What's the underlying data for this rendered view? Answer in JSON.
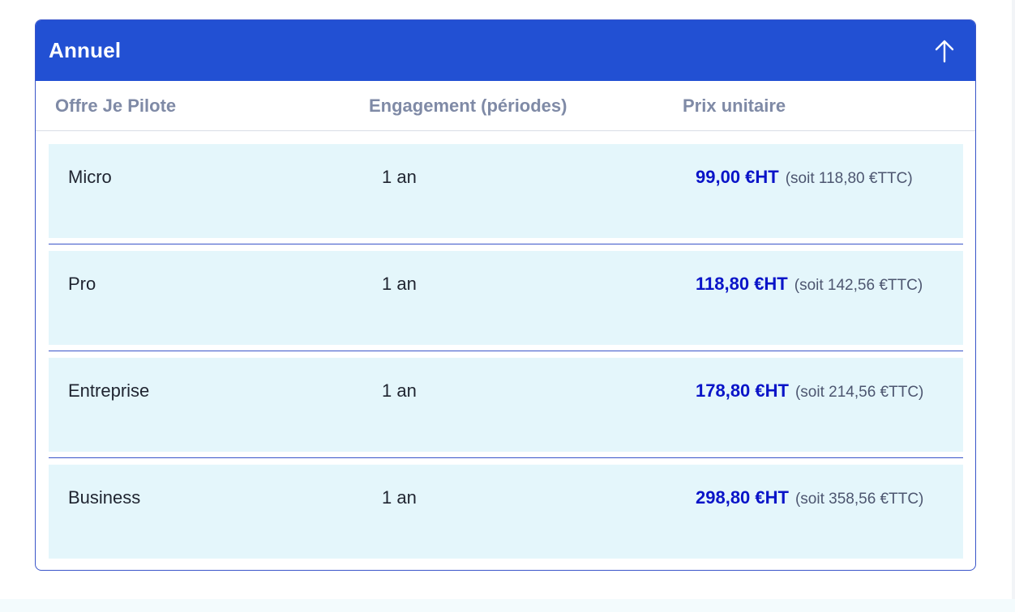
{
  "panel": {
    "title": "Annuel",
    "toggle_icon": "arrow-up-icon"
  },
  "columns": {
    "offer": "Offre Je Pilote",
    "engagement": "Engagement (périodes)",
    "price": "Prix unitaire"
  },
  "rows": [
    {
      "offer": "Micro",
      "engagement": "1 an",
      "price_ht": "99,00 €HT",
      "price_ttc": "(soit 118,80 €TTC)"
    },
    {
      "offer": "Pro",
      "engagement": "1 an",
      "price_ht": "118,80 €HT",
      "price_ttc": "(soit 142,56 €TTC)"
    },
    {
      "offer": "Entreprise",
      "engagement": "1 an",
      "price_ht": "178,80 €HT",
      "price_ttc": "(soit 214,56 €TTC)"
    },
    {
      "offer": "Business",
      "engagement": "1 an",
      "price_ht": "298,80 €HT",
      "price_ttc": "(soit 358,56 €TTC)"
    }
  ],
  "colors": {
    "header_bg": "#2250d3",
    "row_bg": "#e4f6fb",
    "price_ht": "#0a14c8",
    "header_text": "#7f8aa6",
    "border": "#3a55c9"
  }
}
